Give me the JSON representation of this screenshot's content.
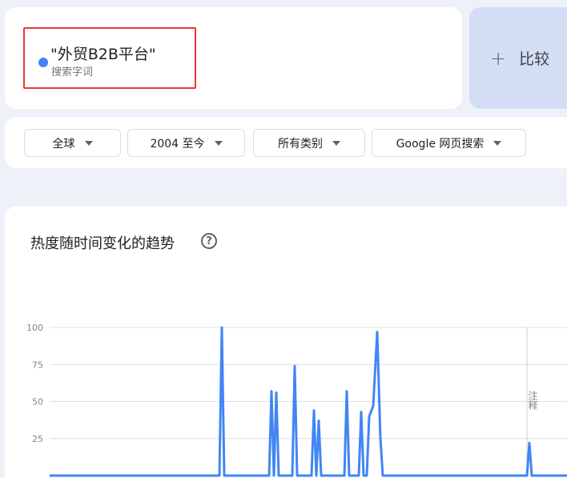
{
  "search_term": {
    "title": "\"外贸B2B平台\"",
    "subtitle": "搜索字词",
    "color": "#4285f4",
    "highlight_color": "#e53935"
  },
  "compare": {
    "icon": "plus-icon",
    "label": "比较"
  },
  "filters": [
    {
      "label": "全球"
    },
    {
      "label": "2004 至今"
    },
    {
      "label": "所有类别"
    },
    {
      "label": "Google 网页搜索"
    }
  ],
  "chart_section": {
    "title": "热度随时间变化的趋势",
    "help_icon": "help-icon",
    "help_glyph": "?"
  },
  "chart_data": {
    "type": "line",
    "y_ticks": [
      "100",
      "75",
      "50",
      "25"
    ],
    "ylim": [
      0,
      100
    ],
    "grid": true,
    "annotation": {
      "text": "注释",
      "position": "right"
    },
    "series": [
      {
        "color": "#4285f4",
        "points": [
          [
            0,
            0
          ],
          [
            212,
            0
          ],
          [
            215,
            100
          ],
          [
            218,
            0
          ],
          [
            274,
            0
          ],
          [
            277,
            57
          ],
          [
            280,
            0
          ],
          [
            283,
            56
          ],
          [
            286,
            0
          ],
          [
            303,
            0
          ],
          [
            306,
            74
          ],
          [
            309,
            0
          ],
          [
            327,
            0
          ],
          [
            330,
            44
          ],
          [
            333,
            0
          ],
          [
            336,
            37
          ],
          [
            339,
            0
          ],
          [
            368,
            0
          ],
          [
            371,
            57
          ],
          [
            374,
            0
          ],
          [
            386,
            0
          ],
          [
            389,
            43
          ],
          [
            392,
            0
          ],
          [
            396,
            0
          ],
          [
            399,
            40
          ],
          [
            404,
            47
          ],
          [
            409,
            97
          ],
          [
            413,
            25
          ],
          [
            416,
            0
          ],
          [
            596,
            0
          ],
          [
            599,
            22
          ],
          [
            602,
            0
          ],
          [
            650,
            0
          ]
        ]
      }
    ]
  }
}
